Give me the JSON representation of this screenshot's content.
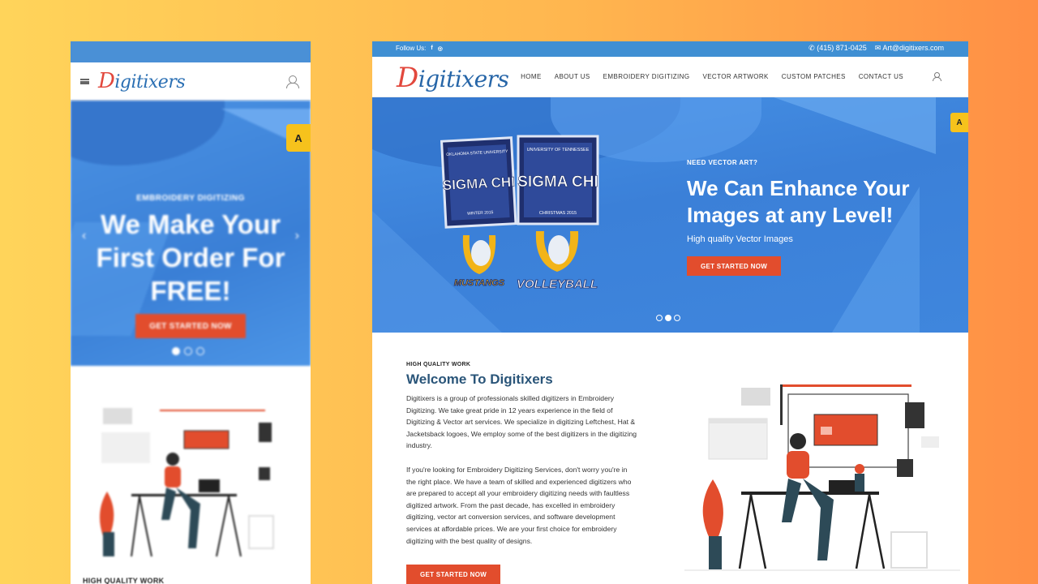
{
  "mobile": {
    "logo": "Digitixers",
    "hero": {
      "kicker": "EMBROIDERY DIGITIZING",
      "title": "We Make Your First Order For FREE!",
      "cta": "GET STARTED NOW"
    },
    "section_kicker": "HIGH QUALITY WORK"
  },
  "desktop": {
    "topbar": {
      "follow_label": "Follow Us:",
      "facebook_icon": "f",
      "instagram_icon": "◎",
      "phone_icon": "✆",
      "phone": "(415) 871-0425",
      "email_icon": "✉",
      "email": "Art@digitixers.com"
    },
    "logo": "Digitixers",
    "nav": [
      "HOME",
      "ABOUT US",
      "EMBROIDERY DIGITIZING",
      "VECTOR ARTWORK",
      "CUSTOM PATCHES",
      "CONTACT US"
    ],
    "hero": {
      "kicker": "NEED VECTOR ART?",
      "title": "We Can Enhance Your Images at any Level!",
      "subtitle": "High quality Vector Images",
      "cta": "GET STARTED NOW",
      "badge": "A",
      "slides": 3,
      "active_slide": 2
    },
    "about": {
      "kicker": "HIGH QUALITY WORK",
      "heading": "Welcome To Digitixers",
      "para1": "Digitixers is a group of professionals skilled digitizers in Embroidery Digitizing. We take great pride in 12 years experience in the field of Digitizing & Vector art services. We specialize in digitizing Leftchest, Hat & Jacketsback logoes, We employ some of the best digitizers in the digitizing industry.",
      "para2": "If you're looking for Embroidery Digitizing Services, don't worry you're in the right place. We have a team of skilled and experienced digitizers who are prepared to accept all your embroidery digitizing needs with faultless digitized artwork. From the past decade, has excelled in embroidery digitizing, vector art conversion services, and software development services at affordable prices. We are your first choice for embroidery digitizing with the best quality of designs.",
      "cta": "GET STARTED NOW"
    },
    "patches": {
      "p1_top": "OKLAHOMA STATE UNIVERSITY",
      "p1_main": "SIGMA CHI",
      "p1_bottom": "WINTER 2015",
      "p2_top": "UNIVERSITY OF TENNESSEE",
      "p2_main": "SIGMA CHI",
      "p2_bottom": "CHRISTMAS 2015",
      "p3": "MUSTANGS",
      "p4": "VOLLEYBALL"
    }
  },
  "colors": {
    "accent": "#e24d2d",
    "brand_blue": "#3f8fd3",
    "heading_blue": "#2a5579",
    "badge_yellow": "#f6c21c"
  }
}
